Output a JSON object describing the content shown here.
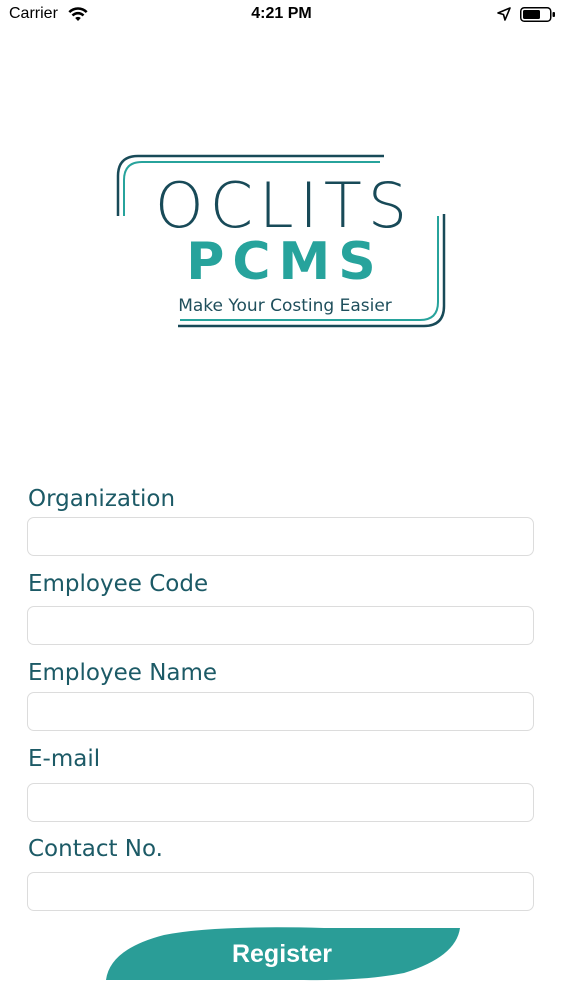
{
  "status_bar": {
    "carrier": "Carrier",
    "time": "4:21 PM",
    "icons": [
      "wifi-icon",
      "location-arrow-icon",
      "battery-icon"
    ]
  },
  "logo": {
    "title": "OCLITS",
    "subtitle": "PCMS",
    "tagline": "Make Your Costing Easier",
    "colors": {
      "dark": "#184a58",
      "accent": "#27a39c"
    }
  },
  "form": {
    "fields": [
      {
        "label": "Organization",
        "value": ""
      },
      {
        "label": "Employee Code",
        "value": ""
      },
      {
        "label": "Employee Name",
        "value": ""
      },
      {
        "label": "E-mail",
        "value": ""
      },
      {
        "label": "Contact No.",
        "value": ""
      }
    ]
  },
  "register": {
    "label": "Register",
    "color": "#2a9d97"
  }
}
